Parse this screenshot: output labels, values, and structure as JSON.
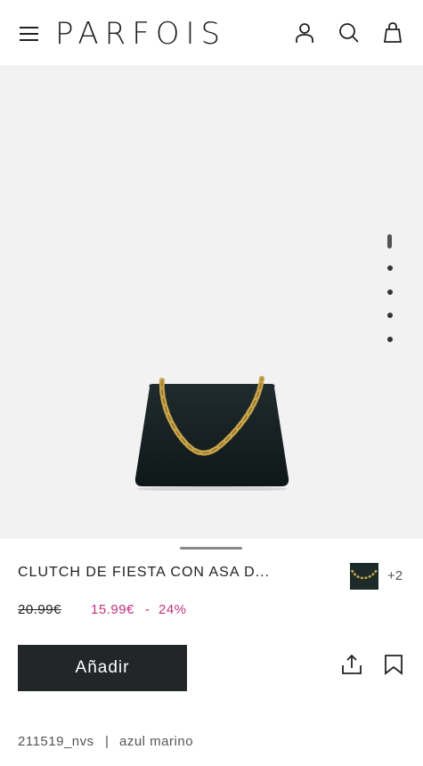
{
  "header": {
    "logo": "PARFOIS",
    "icons": [
      "menu-icon",
      "user-icon",
      "search-icon",
      "bag-icon"
    ]
  },
  "gallery": {
    "image": "navy clutch with gold chain handle",
    "slide_count": 5,
    "active_slide": 1
  },
  "product": {
    "title": "CLUTCH DE FIESTA CON ASA D...",
    "more_colors": "+2",
    "price_old": "20.99€",
    "price_new": "15.99€",
    "discount_sep": "-",
    "discount": "24%",
    "add_label": "Añadir",
    "reference": "211519_nvs",
    "meta_sep": "|",
    "color_name": "azul marino"
  },
  "colors": {
    "accent": "#c2337f",
    "button_bg": "#222629",
    "image_bg": "#f2f2f2"
  }
}
